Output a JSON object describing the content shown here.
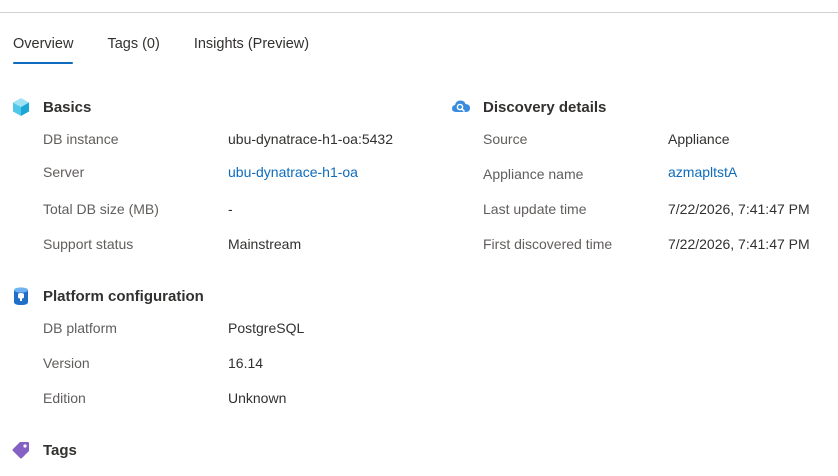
{
  "tabs": [
    {
      "label": "Overview",
      "active": true
    },
    {
      "label": "Tags (0)",
      "active": false
    },
    {
      "label": "Insights (Preview)",
      "active": false
    }
  ],
  "basics": {
    "title": "Basics",
    "icon": "cube-icon",
    "rows": [
      {
        "label": "DB instance",
        "value": "ubu-dynatrace-h1-oa:5432"
      },
      {
        "label": "Server",
        "value": "ubu-dynatrace-h1-oa"
      },
      {
        "label": "Total DB size (MB)",
        "value": "-"
      },
      {
        "label": "Support status",
        "value": "Mainstream"
      }
    ]
  },
  "discovery": {
    "title": "Discovery details",
    "icon": "cloud-search-icon",
    "rows": [
      {
        "label": "Source",
        "value": "Appliance"
      },
      {
        "label": "Appliance name",
        "value": "azmapltstA"
      },
      {
        "label": "Last update time",
        "value": "7/22/2026, 7:41:47 PM"
      },
      {
        "label": "First discovered time",
        "value": "7/22/2026, 7:41:47 PM"
      }
    ]
  },
  "platform": {
    "title": "Platform configuration",
    "icon": "database-icon",
    "rows": [
      {
        "label": "DB platform",
        "value": "PostgreSQL"
      },
      {
        "label": "Version",
        "value": "16.14"
      },
      {
        "label": "Edition",
        "value": "Unknown"
      }
    ]
  },
  "tags": {
    "title": "Tags",
    "icon": "tag-icon"
  },
  "colors": {
    "accent": "#0f6cbd",
    "label": "#605e5c",
    "text": "#323130",
    "divider": "#d2d0ce"
  }
}
